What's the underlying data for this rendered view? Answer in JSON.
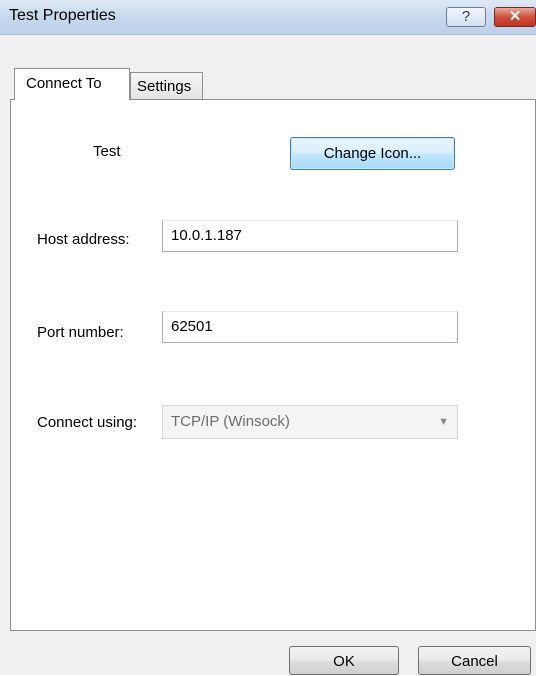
{
  "window": {
    "title": "Test Properties",
    "help_glyph": "?",
    "close_glyph": "✕"
  },
  "tabs": [
    {
      "label": "Connect To",
      "selected": true
    },
    {
      "label": "Settings",
      "selected": false
    }
  ],
  "connect_to": {
    "connection_name": "Test",
    "change_icon_label": "Change Icon...",
    "host_address_label": "Host address:",
    "host_address_value": "10.0.1.187",
    "port_number_label": "Port number:",
    "port_number_value": "62501",
    "connect_using_label": "Connect using:",
    "connect_using_value": "TCP/IP (Winsock)",
    "connect_using_arrow": "▼"
  },
  "footer": {
    "ok_label": "OK",
    "cancel_label": "Cancel"
  }
}
